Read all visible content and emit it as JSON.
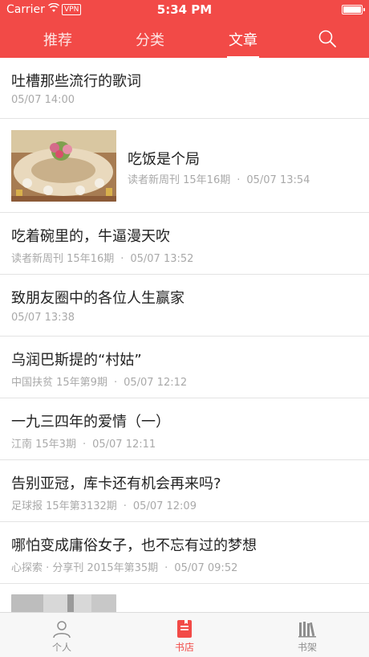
{
  "status_bar": {
    "carrier": "Carrier",
    "vpn": "VPN",
    "time": "5:34 PM"
  },
  "nav": {
    "tabs": [
      "推荐",
      "分类",
      "文章"
    ],
    "active_tab": "文章",
    "search_icon": "search-icon",
    "accent_color": "#f24a47"
  },
  "articles": [
    {
      "title": "吐槽那些流行的歌词",
      "source": "",
      "time": "05/07 14:00"
    },
    {
      "title": "吃饭是个局",
      "source": "读者新周刊 15年16期",
      "time": "05/07 13:54",
      "thumbnail": "banquet-table-image"
    },
    {
      "title": "吃着碗里的，牛逼漫天吹",
      "source": "读者新周刊 15年16期",
      "time": "05/07 13:52"
    },
    {
      "title": "致朋友圈中的各位人生赢家",
      "source": "",
      "time": "05/07 13:38"
    },
    {
      "title": "乌润巴斯提的“村姑”",
      "source": "中国扶贫 15年第9期",
      "time": "05/07 12:12"
    },
    {
      "title": "一九三四年的爱情（一）",
      "source": "江南 15年3期",
      "time": "05/07 12:11"
    },
    {
      "title": "告别亚冠，库卡还有机会再来吗?",
      "source": "足球报 15年第3132期",
      "time": "05/07 12:09"
    },
    {
      "title": "哪怕变成庸俗女子，也不忘有过的梦想",
      "source": "心探索 · 分享刊 2015年第35期",
      "time": "05/07 09:52"
    }
  ],
  "tabbar": {
    "items": [
      {
        "label": "个人",
        "icon": "person-icon"
      },
      {
        "label": "书店",
        "icon": "bookstore-icon"
      },
      {
        "label": "书架",
        "icon": "bookshelf-icon"
      }
    ],
    "active": "书店"
  }
}
